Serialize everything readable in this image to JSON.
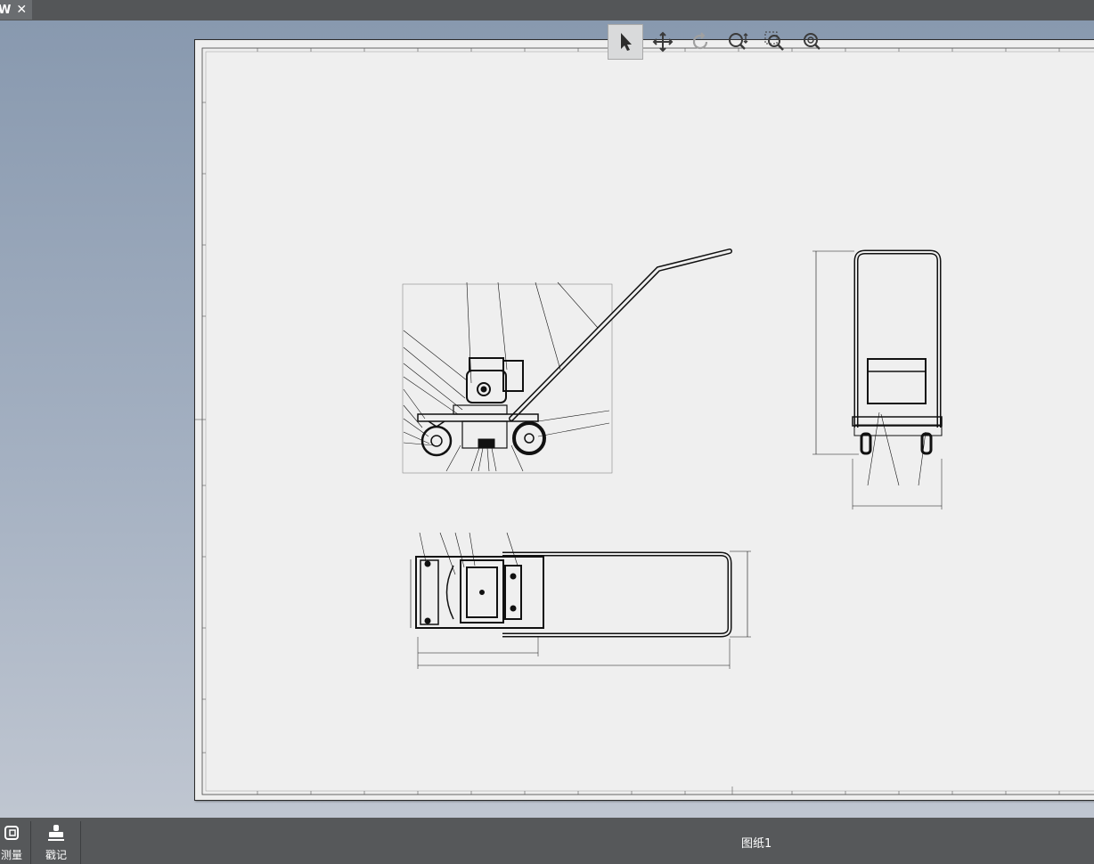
{
  "tab": {
    "label": "W",
    "close": "✕"
  },
  "toolbar": {
    "tools": [
      {
        "name": "select-tool",
        "icon": "cursor-icon",
        "active": true
      },
      {
        "name": "pan-tool",
        "icon": "move-icon",
        "active": false
      },
      {
        "name": "rotate-tool",
        "icon": "rotate-icon",
        "active": false,
        "disabled": true
      },
      {
        "name": "zoom-tool",
        "icon": "zoom-updown-icon",
        "active": false
      },
      {
        "name": "zoom-window-tool",
        "icon": "zoom-window-icon",
        "active": false
      },
      {
        "name": "zoom-fit-tool",
        "icon": "zoom-fit-icon",
        "active": false
      }
    ]
  },
  "bottom": {
    "measure_label": "测量",
    "stamp_label": "戳记",
    "sheet_name": "图纸1"
  },
  "colors": {
    "topbar": "#545658",
    "sheet": "#efefef",
    "bottombar": "#56585a",
    "line": "#111111"
  }
}
